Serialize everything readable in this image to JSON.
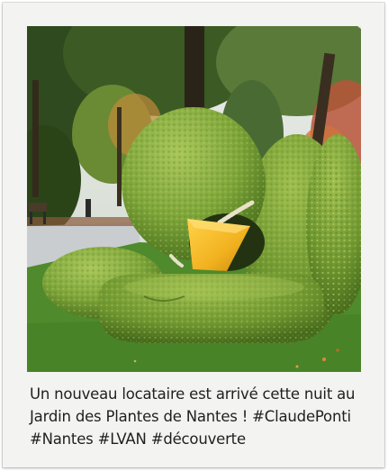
{
  "photo": {
    "subject": "hedge-sculpture-creature"
  },
  "caption": {
    "lines": [
      "Un nouveau locataire est arrivé cette nuit au",
      "Jardin des Plantes de Nantes ! #ClaudePonti",
      "#Nantes #LVAN #découverte"
    ]
  },
  "colors": {
    "frame": "#f3f3f1",
    "hedge": "#7fa63a",
    "beak": "#f2b220",
    "lawn": "#4f8a2c",
    "path": "#c9cdd0"
  }
}
